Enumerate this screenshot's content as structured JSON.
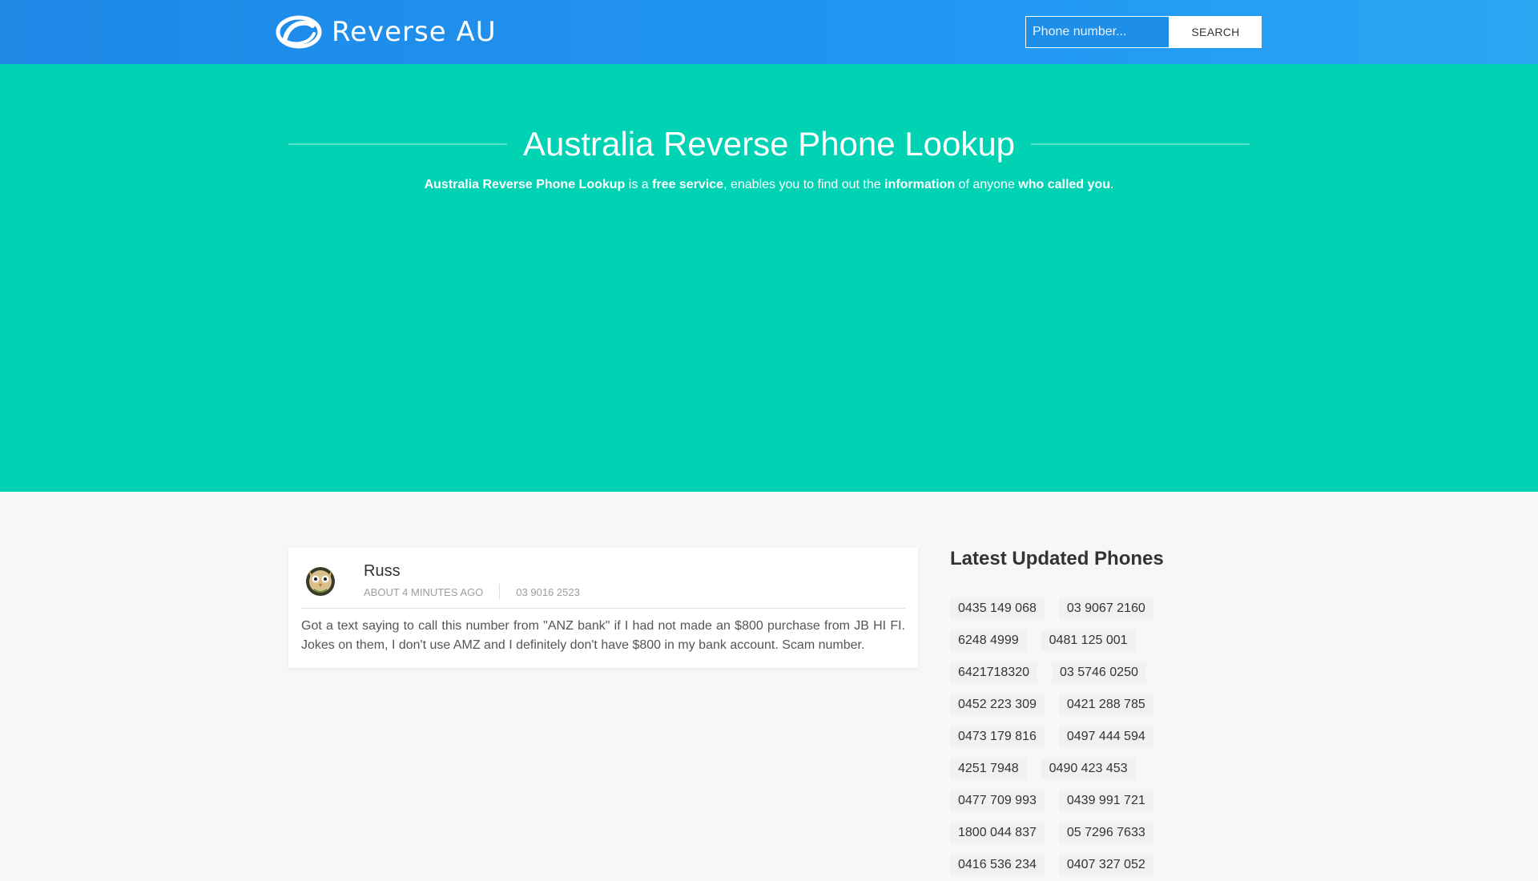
{
  "header": {
    "logo_text": "Reverse AU",
    "logo_icon": "reverse-phone-logo-icon",
    "search_placeholder": "Phone number...",
    "search_button": "SEARCH"
  },
  "hero": {
    "title": "Australia Reverse Phone Lookup",
    "subtitle": {
      "p1": "Australia Reverse Phone Lookup",
      "p2": " is a ",
      "p3": "free service",
      "p4": ", enables you to find out the ",
      "p5": "information",
      "p6": " of anyone ",
      "p7": "who called you",
      "p8": "."
    }
  },
  "comment": {
    "author": "Russ",
    "time": "ABOUT 4 MINUTES AGO",
    "phone": "03 9016 2523",
    "text": "Got a text saying to call this number from \"ANZ bank\" if I had not made an $800 purchase from JB HI FI. Jokes on them, I don't use AMZ and I definitely don't have $800 in my bank account. Scam number."
  },
  "sidebar": {
    "title": "Latest Updated Phones",
    "phones": [
      [
        "0435 149 068",
        "03 9067 2160"
      ],
      [
        "6248 4999",
        "0481 125 001"
      ],
      [
        "6421718320",
        "03 5746 0250"
      ],
      [
        "0452 223 309",
        "0421 288 785"
      ],
      [
        "0473 179 816",
        "0497 444 594"
      ],
      [
        "4251 7948",
        "0490 423 453"
      ],
      [
        "0477 709 993",
        "0439 991 721"
      ],
      [
        "1800 044 837",
        "05 7296 7633"
      ],
      [
        "0416 536 234",
        "0407 327 052"
      ]
    ]
  },
  "colors": {
    "header": "#2196f3",
    "hero": "#00d2b4",
    "background": "#f7f7f7"
  }
}
